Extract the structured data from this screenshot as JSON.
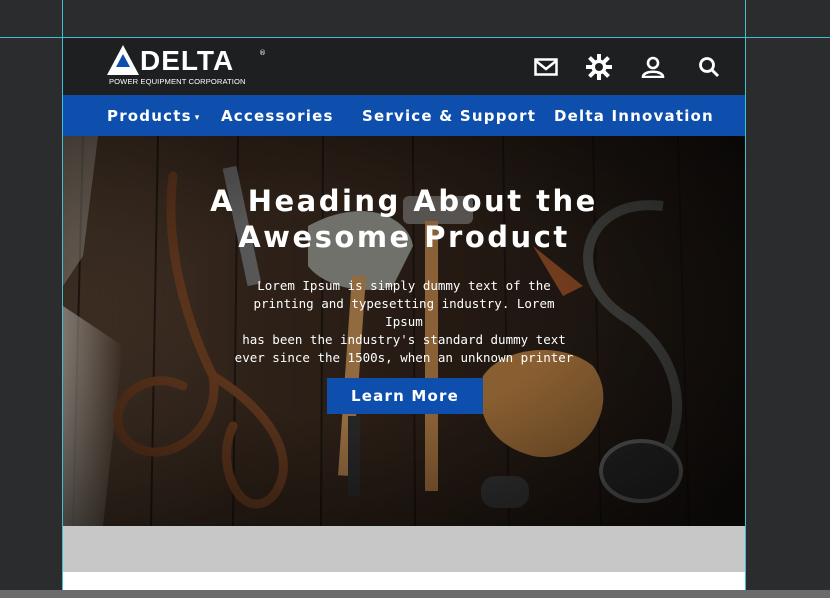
{
  "brand": {
    "name": "DELTA",
    "registered": "®",
    "tagline": "POWER EQUIPMENT CORPORATION"
  },
  "utility_icons": [
    "mail-icon",
    "gear-icon",
    "user-icon",
    "search-icon"
  ],
  "nav": {
    "items": [
      {
        "label": "Products",
        "has_dropdown": true,
        "caret": "▾"
      },
      {
        "label": "Accessories"
      },
      {
        "label": "Service & Support"
      },
      {
        "label": "Delta Innovation"
      }
    ]
  },
  "hero": {
    "title_line1": "A Heading About the",
    "title_line2": "Awesome Product",
    "body_lines": [
      "Lorem Ipsum is simply dummy text of the",
      "printing and typesetting industry. Lorem Ipsum",
      "has been the industry's standard dummy text",
      "ever since the 1500s, when an unknown printer"
    ],
    "cta_label": "Learn More"
  },
  "colors": {
    "header_bg": "#1e1f21",
    "nav_bg": "#0e4fae",
    "cta_bg": "#0e4fae",
    "canvas_bg": "#2b2c2e",
    "guide": "#3fbfd0",
    "band": "#c7c7c7"
  }
}
